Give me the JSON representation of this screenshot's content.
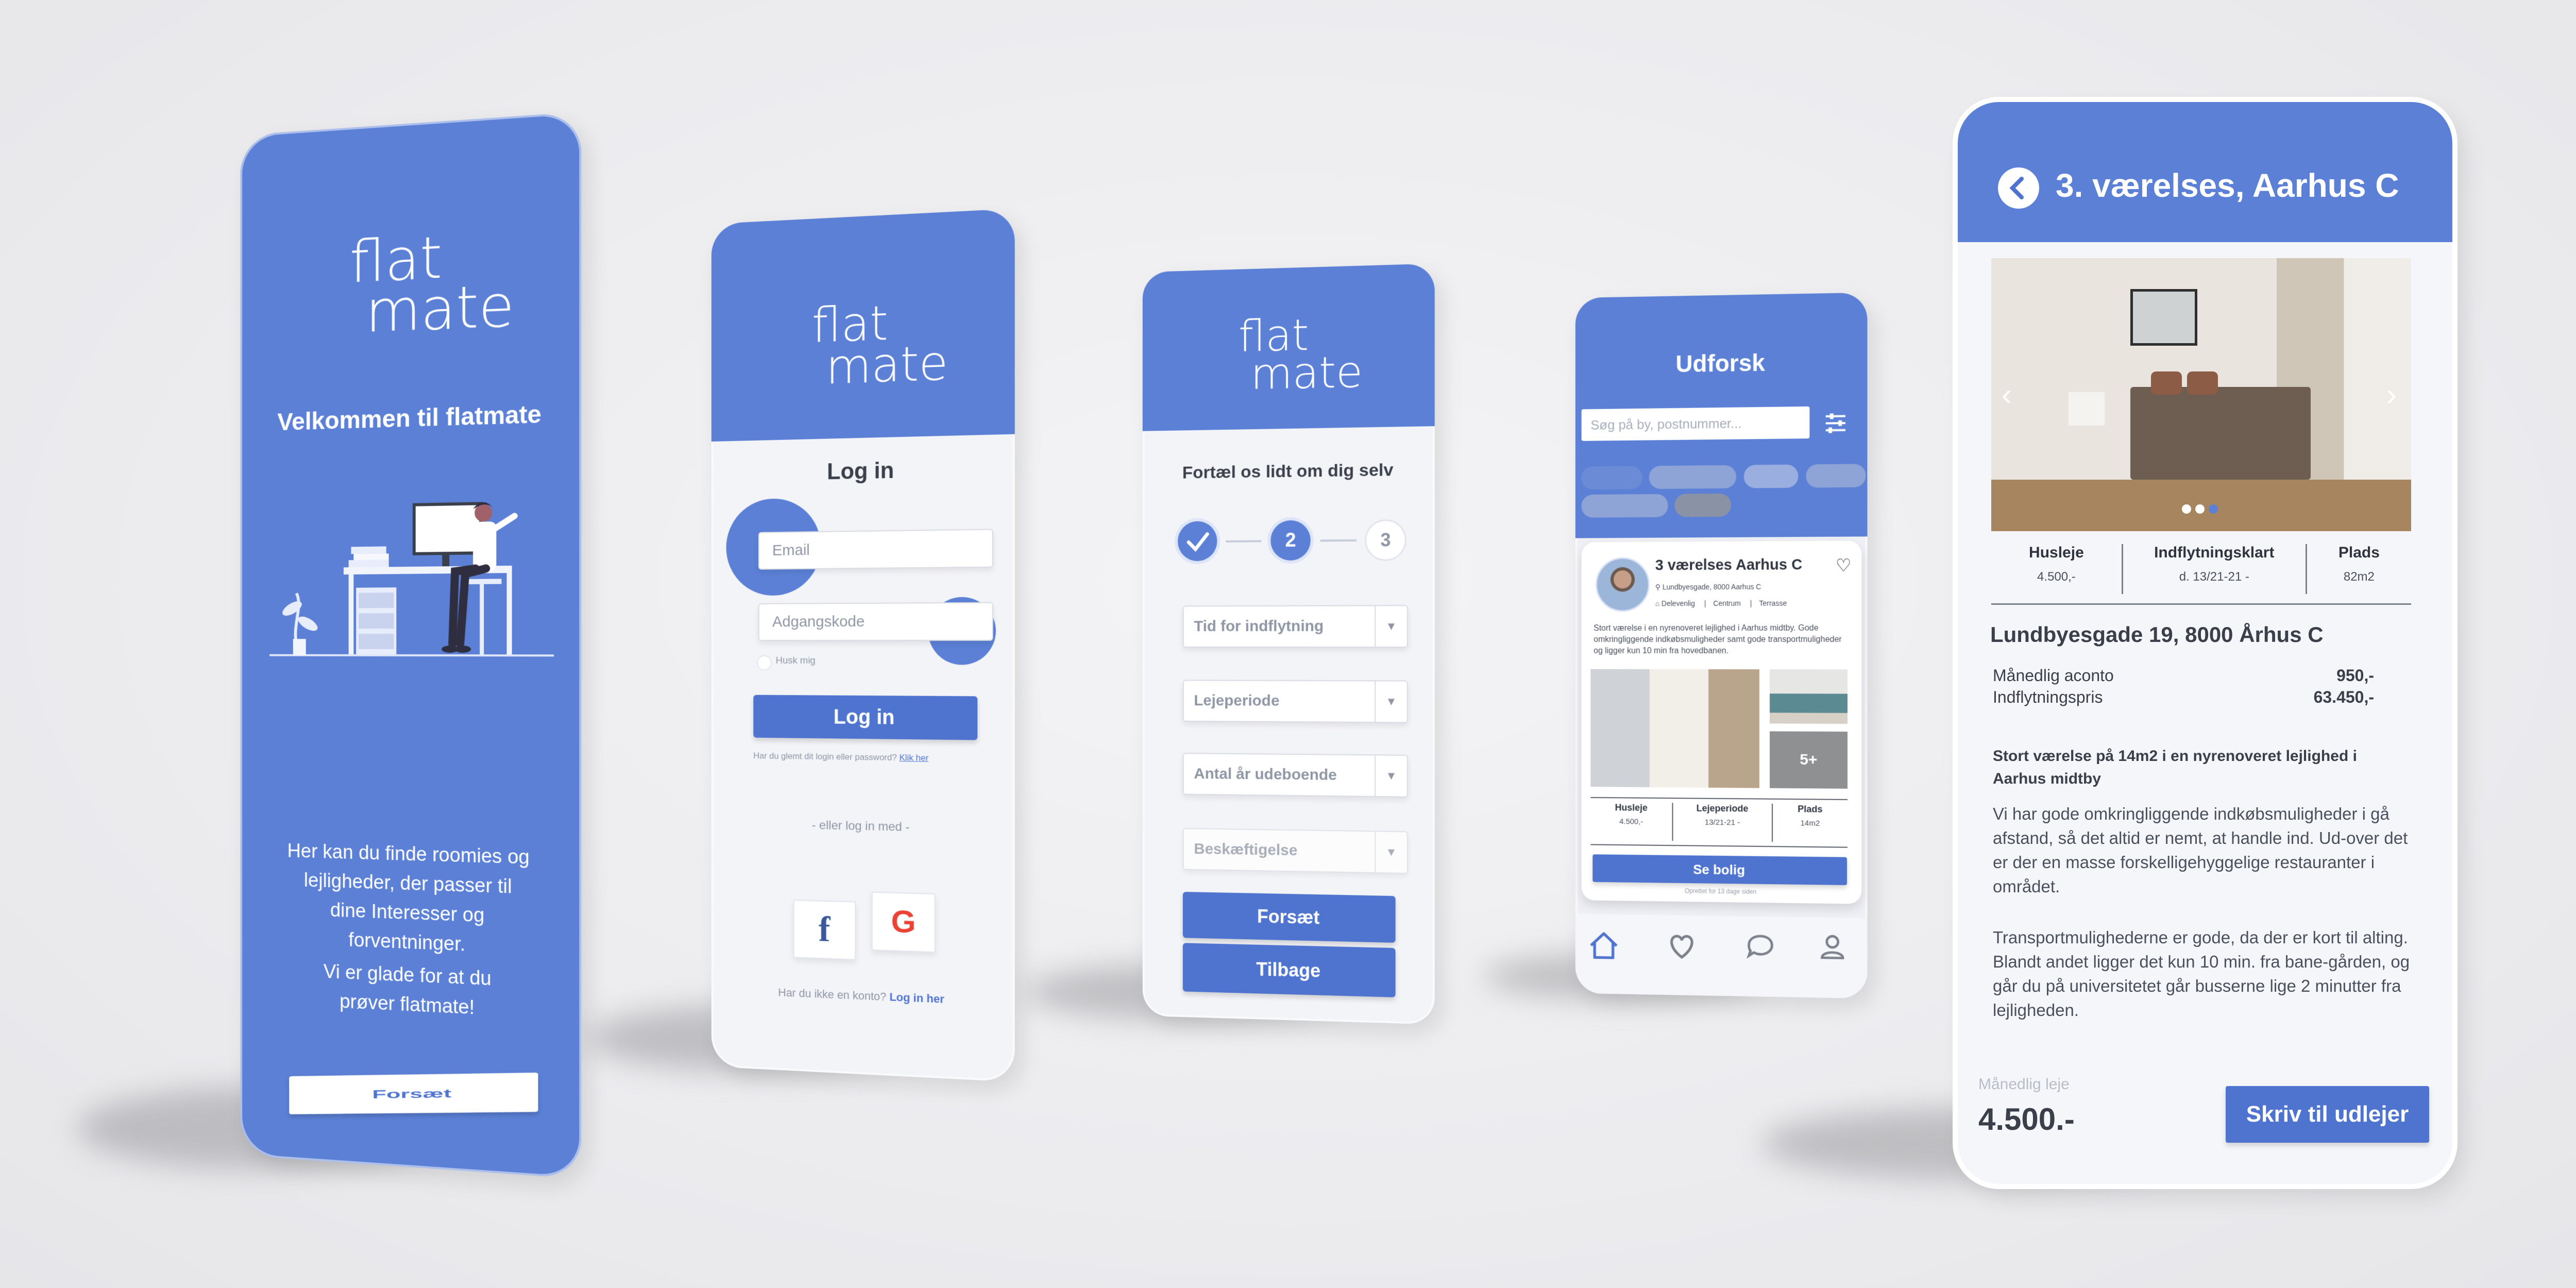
{
  "colors": {
    "brand_blue": "#5b80d6",
    "button_blue": "#4f74cf",
    "background": "#ececef",
    "text_dark": "#3a3f4a"
  },
  "welcome": {
    "brand_line1": "flat",
    "brand_line2": "mate",
    "title": "Velkommen til flatmate",
    "description": "Her kan du  finde roomies og lejligheder, der passer til dine Interesser og forventninger.",
    "greeting": "Vi er glade for at du prøver flatmate!",
    "continue_label": "Forsæt",
    "illustration": "desk-illustration"
  },
  "login": {
    "brand_line1": "flat",
    "brand_line2": "mate",
    "title": "Log in",
    "email_placeholder": "Email",
    "password_placeholder": "Adgangskode",
    "remember_label": "Husk mig",
    "login_label": "Log in",
    "forgot_text": "Har du glemt dit login eller password?",
    "forgot_link": "Klik her",
    "or_text": "- eller log in med -",
    "facebook_glyph": "f",
    "google_glyph": "G",
    "no_account_text": "Har du ikke en konto?",
    "signup_link": "Log in her"
  },
  "onboarding": {
    "brand_line1": "flat",
    "brand_line2": "mate",
    "title": "Fortæl os lidt om dig selv",
    "step_done_icon": "check-icon",
    "step_current": "2",
    "step_next": "3",
    "fields": [
      "Tid for indflytning",
      "Lejeperiode",
      "Antal år udeboende",
      "Beskæftigelse"
    ],
    "continue_label": "Forsæt",
    "back_label": "Tilbage"
  },
  "explore": {
    "title": "Udforsk",
    "search_placeholder": "Søg på by, postnummer...",
    "listing": {
      "title": "3 værelses Aarhus C",
      "address": "Lundbyesgade, 8000 Aarhus C",
      "tags": [
        "Delevenlig",
        "Centrum",
        "Terrasse"
      ],
      "description": "Stort værelse i en nyrenoveret lejlighed i Aarhus midtby. Gode omkringliggende indkøbsmuligheder samt gode transportmuligheder og ligger kun 10 min fra hovedbanen.",
      "more_photos": "5+",
      "stats": [
        {
          "label": "Husleje",
          "value": "4.500,-"
        },
        {
          "label": "Lejeperiode",
          "value": "13/21-21 -"
        },
        {
          "label": "Plads",
          "value": "14m2"
        }
      ],
      "cta": "Se bolig",
      "posted": "Oprettet for 13 dage siden"
    },
    "nav": [
      "home-icon",
      "heart-icon",
      "chat-icon",
      "profile-icon"
    ]
  },
  "detail": {
    "title": "3. værelses, Aarhus C",
    "stats": [
      {
        "label": "Husleje",
        "value": "4.500,-"
      },
      {
        "label": "Indflytningsklart",
        "value": "d. 13/21-21 -"
      },
      {
        "label": "Plads",
        "value": "82m2"
      }
    ],
    "address": "Lundbyesgade 19, 8000 Århus C",
    "costs": [
      {
        "label": "Månedlig aconto",
        "value": "950,-"
      },
      {
        "label": "Indflytningspris",
        "value": "63.450,-"
      }
    ],
    "subtitle": "Stort værelse på 14m2 i en nyrenoveret lejlighed i Aarhus midtby",
    "paragraph1": "Vi har gode omkringliggende indkøbsmuligheder i gå afstand, så det altid er nemt, at handle ind. Ud-over det er der en masse forskelligehyggelige restauranter i området.",
    "paragraph2": "Transportmulighederne er gode, da der er kort til alting. Blandt andet ligger det kun 10 min. fra bane-gården, og går du på universitetet går busserne lige 2 minutter fra lejligheden.",
    "rent_label": "Månedlig leje",
    "rent_value": "4.500.-",
    "cta": "Skriv til udlejer"
  }
}
